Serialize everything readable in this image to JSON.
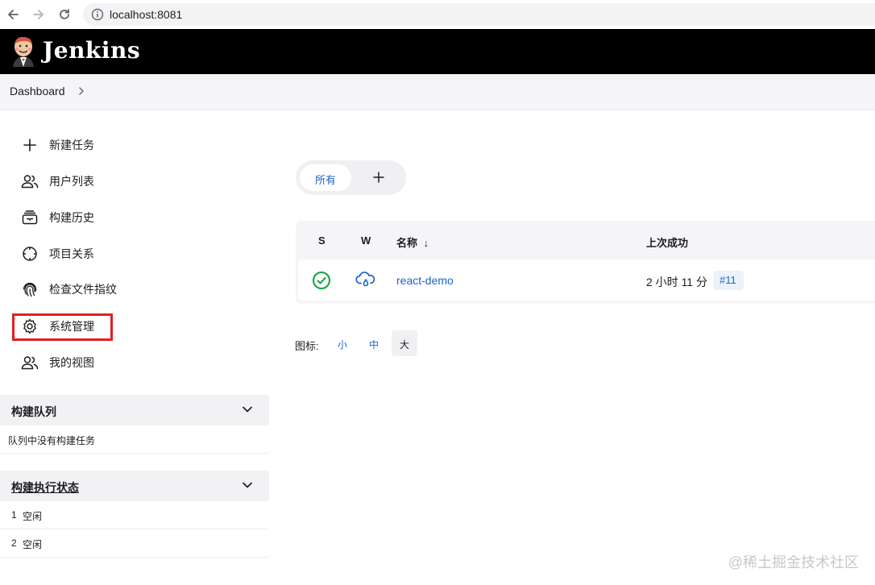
{
  "browser": {
    "url": "localhost:8081"
  },
  "header": {
    "brand": "Jenkins"
  },
  "breadcrumb": {
    "items": [
      "Dashboard"
    ]
  },
  "sidebar": {
    "tasks": [
      {
        "label": "新建任务",
        "icon": "plus-icon"
      },
      {
        "label": "用户列表",
        "icon": "users-icon"
      },
      {
        "label": "构建历史",
        "icon": "history-icon"
      },
      {
        "label": "项目关系",
        "icon": "relationship-icon"
      },
      {
        "label": "检查文件指纹",
        "icon": "fingerprint-icon"
      },
      {
        "label": "系统管理",
        "icon": "gear-icon",
        "highlighted": true
      },
      {
        "label": "我的视图",
        "icon": "users-icon"
      }
    ],
    "build_queue": {
      "title": "构建队列",
      "empty_text": "队列中没有构建任务"
    },
    "executors": {
      "title": "构建执行状态",
      "rows": [
        {
          "num": "1",
          "status": "空闲"
        },
        {
          "num": "2",
          "status": "空闲"
        }
      ]
    }
  },
  "main": {
    "tabs": [
      {
        "label": "所有",
        "active": true
      }
    ],
    "table": {
      "headers": {
        "s": "S",
        "w": "W",
        "name": "名称",
        "sort_arrow": "↓",
        "last_success": "上次成功"
      },
      "rows": [
        {
          "status": "success",
          "weather": "cloud-rain",
          "name": "react-demo",
          "last_success": "2 小时 11 分",
          "build": "#11"
        }
      ]
    },
    "icon_size": {
      "label": "图标:",
      "options": [
        "小",
        "中",
        "大"
      ],
      "selected": "大"
    }
  },
  "watermark": "@稀土掘金技术社区",
  "colors": {
    "accent": "#1c64c8",
    "success": "#1ea64b",
    "highlight_border": "#e02020",
    "header_bg": "#000000"
  }
}
